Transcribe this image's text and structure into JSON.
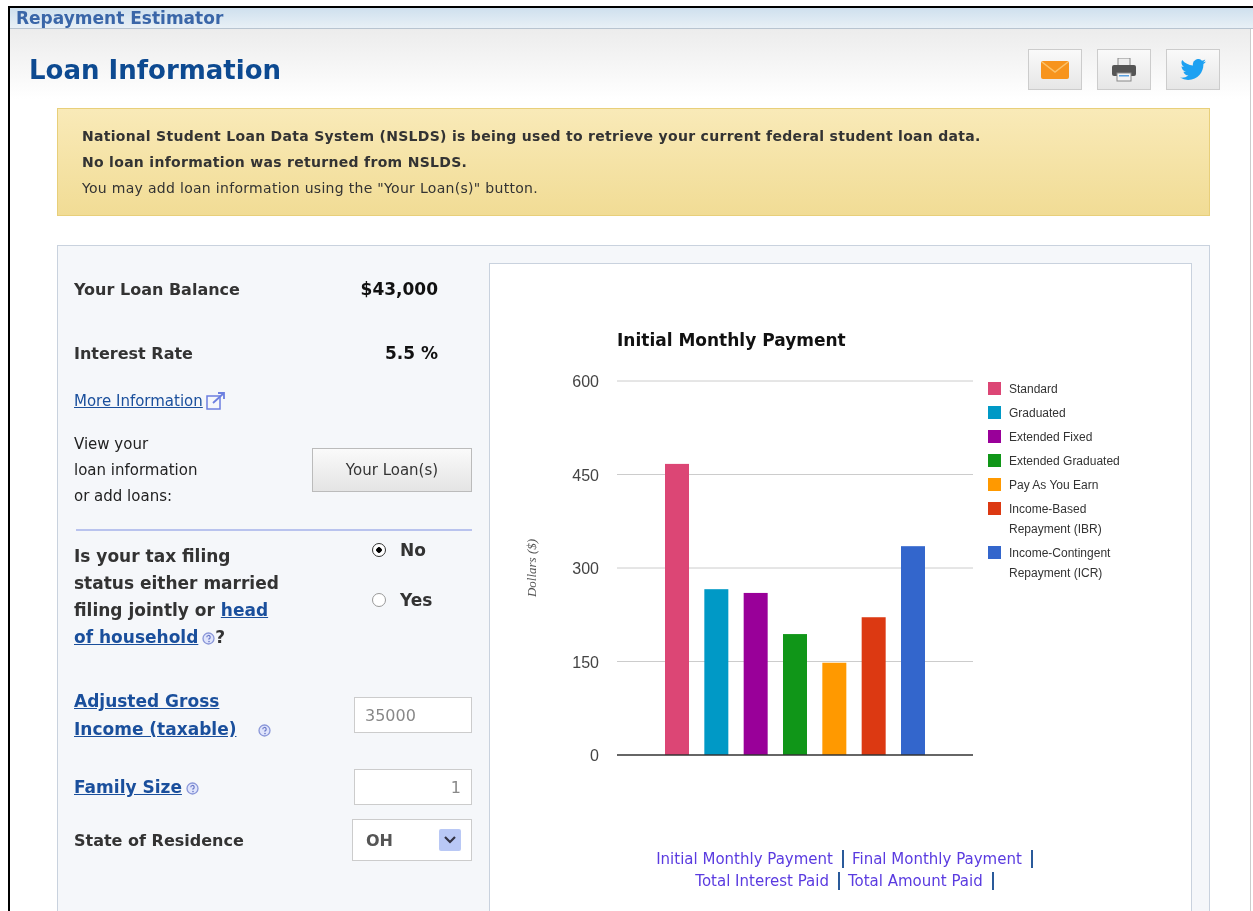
{
  "header": {
    "title": "Repayment Estimator"
  },
  "page": {
    "title": "Loan Information"
  },
  "share_buttons": [
    {
      "kind": "email"
    },
    {
      "kind": "print"
    },
    {
      "kind": "twitter"
    }
  ],
  "notice": {
    "lines": [
      {
        "text": "National Student Loan Data System (NSLDS) is being used to retrieve your current federal student loan data.",
        "bold": true
      },
      {
        "text": "No loan information was returned from NSLDS.",
        "bold": true
      },
      {
        "text": "You may add loan information using the \"Your Loan(s)\" button.",
        "bold": false
      }
    ]
  },
  "loan": {
    "balance_label": "Your Loan Balance",
    "balance_value": "$43,000",
    "rate_label": "Interest Rate",
    "rate_value": "5.5 %",
    "more_info_link": "More Information",
    "view_text": "View your\nloan information\nor add loans:",
    "loans_button": "Your Loan(s)"
  },
  "tax_question": {
    "text": "Is your tax filing status either married filing jointly or",
    "link": "head of household",
    "suffix": "?",
    "options": [
      {
        "label": "No",
        "selected": true
      },
      {
        "label": "Yes",
        "selected": false
      }
    ]
  },
  "income": {
    "label": "Adjusted Gross Income (taxable)",
    "value": "35000"
  },
  "family_size": {
    "label": "Family Size",
    "value": "1"
  },
  "state": {
    "label": "State of Residence",
    "value": "OH"
  },
  "chart": {
    "chart_data": {
      "type": "bar",
      "title": "Initial Monthly Payment",
      "ylabel": "Dollars ($)",
      "ylim": [
        0,
        600
      ],
      "yticks": [
        0,
        150,
        300,
        450,
        600
      ],
      "grid": true,
      "legend": "right",
      "series": [
        {
          "name": "Standard",
          "color": "#dc4675",
          "values": [
            467
          ]
        },
        {
          "name": "Graduated",
          "color": "#0099c6",
          "values": [
            266
          ]
        },
        {
          "name": "Extended Fixed",
          "color": "#990099",
          "values": [
            260
          ]
        },
        {
          "name": "Extended Graduated",
          "color": "#109618",
          "values": [
            194
          ]
        },
        {
          "name": "Pay As You Earn",
          "color": "#ff9900",
          "values": [
            148
          ]
        },
        {
          "name": "Income-Based Repayment (IBR)",
          "color": "#dc3912",
          "values": [
            221
          ]
        },
        {
          "name": "Income-Contingent Repayment (ICR)",
          "color": "#3366cc",
          "values": [
            335
          ]
        }
      ]
    }
  },
  "chart_links": [
    "Initial Monthly Payment",
    "Final Monthly Payment",
    "Total Interest Paid",
    "Total Amount Paid"
  ]
}
